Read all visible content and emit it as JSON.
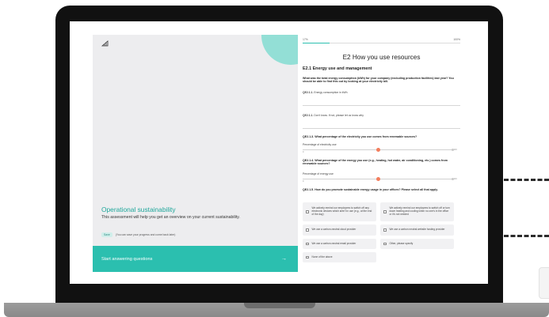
{
  "intro": {
    "logo_icon": "bar-chart-icon",
    "title": "Operational sustainability",
    "subtitle": "This assessment will help you get an overview on your current sustainability.",
    "tag": "Save",
    "save_note": "(You can save your progress and come back later)",
    "start_button": "Start answering questions",
    "arrow_icon": "arrow-right-icon"
  },
  "progress": {
    "start": "17%",
    "end": "100%",
    "value": 0.17
  },
  "page": {
    "title": "E2 How you use resources",
    "section": "E2.1 Energy use and management",
    "intro_question": "What was the total energy consumption (kWh) for your company (excluding production facilities) last year? You should be able to find this out by looking at your electricity bill."
  },
  "questions": {
    "q1_label": "QE2.1.1.",
    "q1_text": "Energy consumption in kWh",
    "q2_label": "QE2.1.1.",
    "q2_text": "Don't know. If not, please let us know why",
    "q3_label": "QE2.1.3.",
    "q3_text": "What percentage of the electricity you use comes from renewable sources?",
    "q3_slider_label": "Percentage of electricity use",
    "q3_value": 50,
    "q4_label": "QE2.1.4.",
    "q4_text": "What percentage of the energy you use (e.g., heating, hot water, air conditioning, etc.) comes from renewable sources?",
    "q4_slider_label": "Percentage of energy use",
    "q4_value": 50,
    "slider_min": "0",
    "slider_max": "0/4",
    "q5_label": "QE2.1.5.",
    "q5_text": "How do you promote sustainable energy usage in your offices? Please select all that apply."
  },
  "options": [
    "We actively remind our employees to switch off any electronic devices which aren't in use (e.g., at the end of the day)",
    "We actively remind our employees to switch off or turn down heating and cooling when no one's in the office or it's not needed",
    "We use a carbon-neutral cloud provider",
    "We use a carbon neutral website hosting provider",
    "We use a carbon-neutral email provider",
    "Other, please specify",
    "None of the above"
  ],
  "colors": {
    "accent": "#2bbfaf",
    "accent_light": "#93dfd6",
    "slider_knob": "#f37d5c"
  }
}
